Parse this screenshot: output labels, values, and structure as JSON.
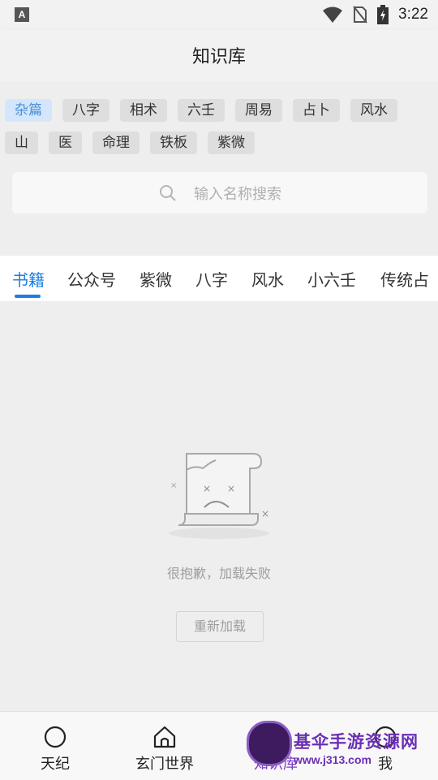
{
  "status_bar": {
    "time": "3:22",
    "left_icon": "A"
  },
  "header": {
    "title": "知识库"
  },
  "tags": {
    "row1": [
      "杂篇",
      "八字",
      "相术",
      "六壬",
      "周易",
      "占卜",
      "风水"
    ],
    "row2": [
      "山",
      "医",
      "命理",
      "铁板",
      "紫微"
    ],
    "active": "杂篇"
  },
  "search": {
    "placeholder": "输入名称搜索"
  },
  "tabs": [
    "书籍",
    "公众号",
    "紫微",
    "八字",
    "风水",
    "小六壬",
    "传统占"
  ],
  "error": {
    "message": "很抱歉，加载失败",
    "reload_label": "重新加载"
  },
  "bottom_nav": [
    {
      "label": "天纪",
      "icon": "circle-icon"
    },
    {
      "label": "玄门世界",
      "icon": "home-icon"
    },
    {
      "label": "知识库",
      "icon": "book-icon"
    },
    {
      "label": "我",
      "icon": "profile-icon"
    }
  ],
  "watermark": {
    "title": "基伞手游资源网",
    "url": "www.j313.com"
  },
  "colors": {
    "accent": "#1a7fe0",
    "active_tag_bg": "#d3e6fb",
    "nav_active": "#7d3cc8"
  }
}
